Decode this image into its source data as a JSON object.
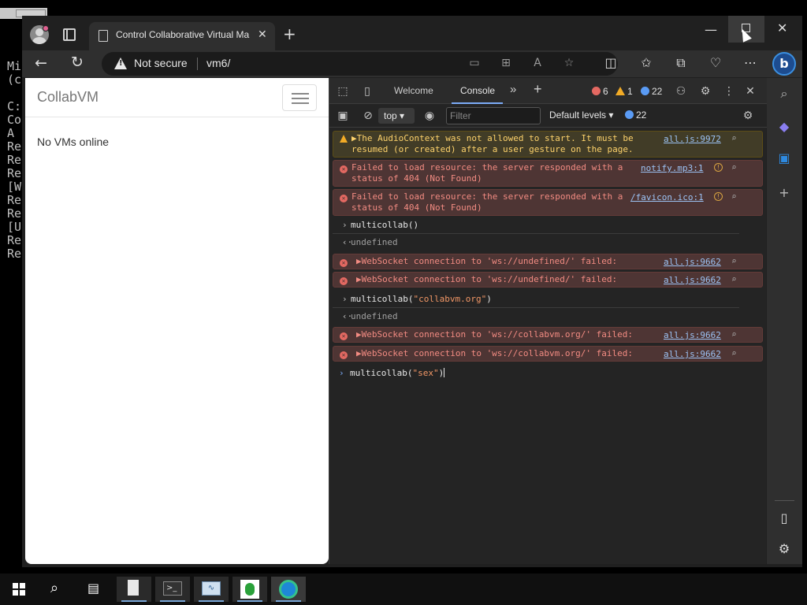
{
  "background_console": {
    "lines": [
      "Mi",
      "(c",
      "",
      "C:",
      "Co",
      "A",
      "Re",
      "Re",
      "Re",
      "[W",
      "Re",
      "Re",
      "[U",
      "Re",
      "Re"
    ]
  },
  "browser": {
    "tab_title": "Control Collaborative Virtual Ma",
    "tab_close": "✕",
    "new_tab": "+",
    "security_label": "Not secure",
    "url": "vm6/",
    "window": {
      "minimize": "—",
      "close": "✕"
    }
  },
  "page": {
    "brand": "CollabVM",
    "message": "No VMs online"
  },
  "devtools": {
    "tabs": {
      "welcome": "Welcome",
      "console": "Console",
      "more": "»",
      "add": "+"
    },
    "counts": {
      "errors": "6",
      "warnings": "1",
      "info": "22"
    },
    "toolbar": {
      "context": "top",
      "filter_placeholder": "Filter",
      "levels": "Default levels ▾",
      "issues": "22"
    },
    "console": [
      {
        "kind": "warn",
        "text": "▶The AudioContext was not allowed to start. It must be\nresumed (or created) after a user gesture on the page.",
        "src": "all.js:9972"
      },
      {
        "kind": "err",
        "text": "Failed to load resource: the server responded with a\nstatus of 404 (Not Found)",
        "src": "notify.mp3:1"
      },
      {
        "kind": "err",
        "text": "Failed to load resource: the server responded with a\nstatus of 404 (Not Found)",
        "src": "/favicon.ico:1"
      },
      {
        "kind": "input",
        "text": "multicollab()"
      },
      {
        "kind": "output",
        "text": "undefined"
      },
      {
        "kind": "err",
        "text": "▶WebSocket connection to 'ws://undefined/' failed:",
        "src": "all.js:9662"
      },
      {
        "kind": "err",
        "text": "▶WebSocket connection to 'ws://undefined/' failed:",
        "src": "all.js:9662"
      },
      {
        "kind": "input",
        "text_pre": "multicollab(",
        "text_str": "\"collabvm.org\"",
        "text_post": ")"
      },
      {
        "kind": "output",
        "text": "undefined"
      },
      {
        "kind": "err",
        "text": "▶WebSocket connection to 'ws://collabvm.org/' failed:",
        "src": "all.js:9662"
      },
      {
        "kind": "err",
        "text": "▶WebSocket connection to 'ws://collabvm.org/' failed:",
        "src": "all.js:9662"
      }
    ],
    "prompt": {
      "pre": "multicollab(",
      "str": "\"sex\"",
      "post": ")"
    }
  },
  "icons": {
    "back": "←",
    "refresh": "↻",
    "favorites": "☆",
    "more": "⋯",
    "settings": "⚙",
    "close": "✕",
    "search": "⌕",
    "plus": "+"
  },
  "colors": {
    "error": "#e46962",
    "warning": "#f2ab26",
    "info": "#5a9bf5",
    "accent": "#7cacf8"
  }
}
